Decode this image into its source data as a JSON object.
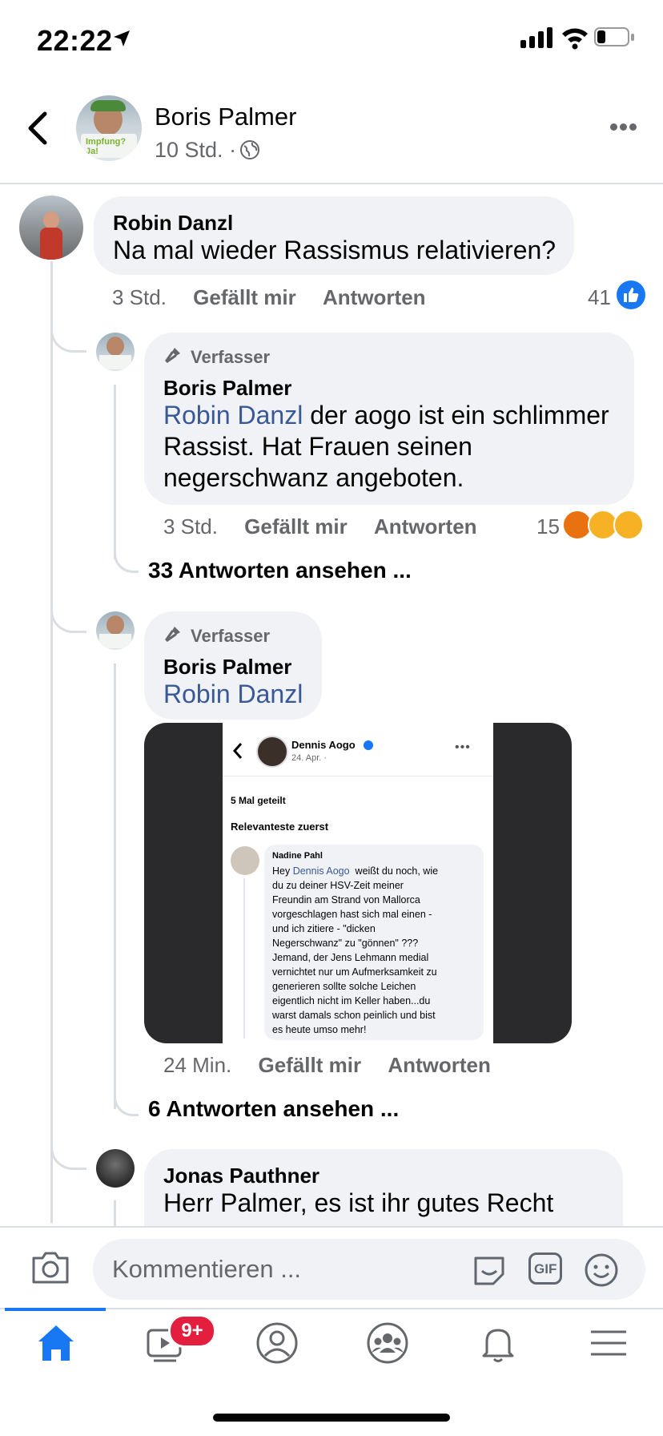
{
  "status_bar": {
    "time": "22:22"
  },
  "header": {
    "author": "Boris Palmer",
    "meta": "10 Std. ·",
    "avatar_sign_text": "Impfung? Ja!"
  },
  "comments": [
    {
      "author": "Robin Danzl",
      "text": "Na mal wieder Rassismus relativieren?",
      "time": "3 Std.",
      "like": "Gefällt mir",
      "reply": "Antworten",
      "reaction_count": "41"
    },
    {
      "badge": "Verfasser",
      "author": "Boris Palmer",
      "mention": "Robin Danzl",
      "text_line1": " der aogo ist ein schlimmer",
      "text_line2": "Rassist. Hat Frauen seinen",
      "text_line3": "negerschwanz angeboten.",
      "time": "3 Std.",
      "like": "Gefällt mir",
      "reply": "Antworten",
      "reaction_count": "15",
      "see_replies": "33 Antworten ansehen ..."
    },
    {
      "badge": "Verfasser",
      "author": "Boris Palmer",
      "mention": "Robin Danzl",
      "time": "24 Min.",
      "like": "Gefällt mir",
      "reply": "Antworten",
      "see_replies": "6 Antworten ansehen ..."
    },
    {
      "author": "Jonas Pauthner",
      "text": "Herr Palmer, es ist ihr gutes Recht"
    }
  ],
  "embedded_screenshot": {
    "profile_name": "Dennis Aogo",
    "date": "24. Apr. ·",
    "shares": "5 Mal geteilt",
    "sort": "Relevanteste zuerst",
    "comment_author": "Nadine Pahl",
    "comment_prefix": "Hey ",
    "comment_mention": "Dennis Aogo",
    "comment_lines": [
      "  weißt du noch, wie",
      "du zu deiner HSV-Zeit meiner",
      "Freundin am Strand von Mallorca",
      "vorgeschlagen hast sich mal einen -",
      "und ich zitiere - \"dicken",
      "Negerschwanz\" zu \"gönnen\" ???",
      "Jemand, der Jens Lehmann medial",
      "vernichtet nur um Aufmerksamkeit zu",
      "generieren sollte solche Leichen",
      "eigentlich nicht im Keller haben...du",
      "warst damals schon peinlich und bist",
      "es heute umso mehr!"
    ]
  },
  "composer": {
    "placeholder": "Kommentieren ...",
    "gif_label": "GIF"
  },
  "tabbar": {
    "video_badge": "9+"
  },
  "colors": {
    "link": "#385898",
    "facebook_blue": "#1877f2",
    "bubble_bg": "#f0f2f5",
    "badge_red": "#e41e3f"
  }
}
